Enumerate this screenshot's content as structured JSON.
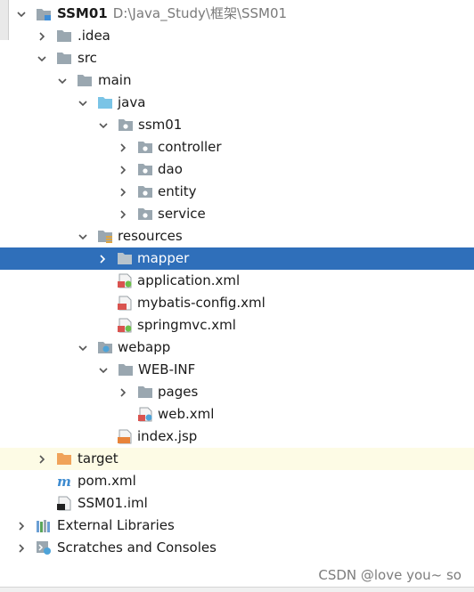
{
  "project": {
    "name": "SSM01",
    "path": "D:\\Java_Study\\框架\\SSM01"
  },
  "tree": {
    "idea": ".idea",
    "src": "src",
    "main": "main",
    "java": "java",
    "package": "ssm01",
    "controller": "controller",
    "dao": "dao",
    "entity": "entity",
    "service": "service",
    "resources": "resources",
    "mapper": "mapper",
    "application_xml": "application.xml",
    "mybatis_config_xml": "mybatis-config.xml",
    "springmvc_xml": "springmvc.xml",
    "webapp": "webapp",
    "web_inf": "WEB-INF",
    "pages": "pages",
    "web_xml": "web.xml",
    "index_jsp": "index.jsp",
    "target": "target",
    "pom_xml": "pom.xml",
    "iml": "SSM01.iml",
    "external_libraries": "External Libraries",
    "scratches": "Scratches and Consoles"
  },
  "watermark": "CSDN @love you~ so",
  "colors": {
    "selection": "#2f6fba",
    "excluded_bg": "#fdfbe5",
    "folder": "#9aa7b0",
    "source_folder": "#7ac4e6",
    "target_folder": "#f0a35a"
  }
}
